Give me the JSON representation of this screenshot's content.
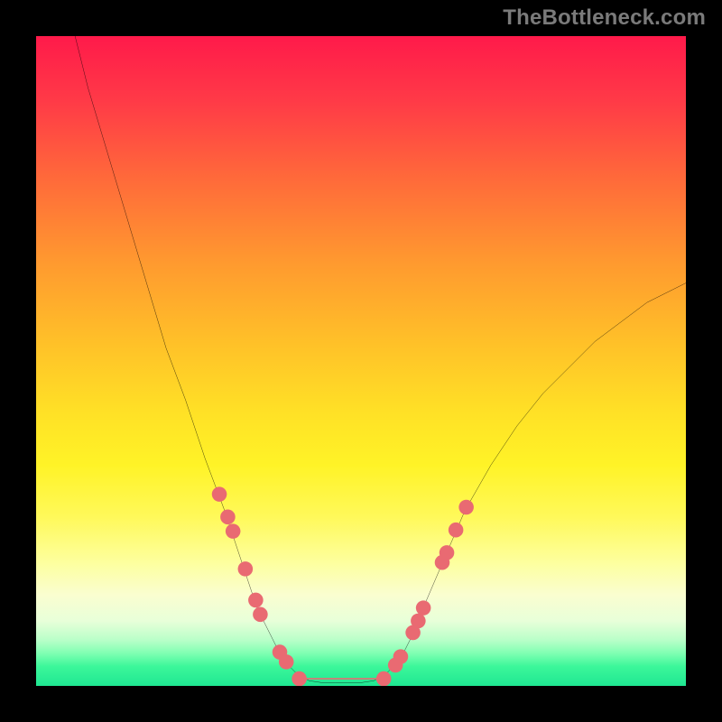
{
  "watermark": "TheBottleneck.com",
  "chart_data": {
    "type": "line",
    "title": "",
    "xlabel": "",
    "ylabel": "",
    "xlim": [
      0,
      100
    ],
    "ylim": [
      0,
      100
    ],
    "grid": false,
    "curve": [
      {
        "x": 6,
        "y": 100
      },
      {
        "x": 8,
        "y": 92
      },
      {
        "x": 11,
        "y": 82
      },
      {
        "x": 14,
        "y": 72
      },
      {
        "x": 17,
        "y": 62
      },
      {
        "x": 20,
        "y": 52
      },
      {
        "x": 23,
        "y": 44
      },
      {
        "x": 26,
        "y": 35
      },
      {
        "x": 29,
        "y": 27
      },
      {
        "x": 32,
        "y": 18
      },
      {
        "x": 34,
        "y": 12
      },
      {
        "x": 36,
        "y": 8
      },
      {
        "x": 38,
        "y": 4
      },
      {
        "x": 40,
        "y": 2
      },
      {
        "x": 42,
        "y": 0.8
      },
      {
        "x": 44,
        "y": 0.5
      },
      {
        "x": 46,
        "y": 0.5
      },
      {
        "x": 48,
        "y": 0.5
      },
      {
        "x": 50,
        "y": 0.5
      },
      {
        "x": 52,
        "y": 0.8
      },
      {
        "x": 54,
        "y": 2
      },
      {
        "x": 56,
        "y": 4
      },
      {
        "x": 58,
        "y": 8
      },
      {
        "x": 60,
        "y": 13
      },
      {
        "x": 63,
        "y": 20
      },
      {
        "x": 66,
        "y": 27
      },
      {
        "x": 70,
        "y": 34
      },
      {
        "x": 74,
        "y": 40
      },
      {
        "x": 78,
        "y": 45
      },
      {
        "x": 82,
        "y": 49
      },
      {
        "x": 86,
        "y": 53
      },
      {
        "x": 90,
        "y": 56
      },
      {
        "x": 94,
        "y": 59
      },
      {
        "x": 98,
        "y": 61
      },
      {
        "x": 100,
        "y": 62
      }
    ],
    "markers_left": [
      {
        "x": 28.2,
        "y": 29.5
      },
      {
        "x": 29.5,
        "y": 26.0
      },
      {
        "x": 30.3,
        "y": 23.8
      },
      {
        "x": 32.2,
        "y": 18.0
      },
      {
        "x": 33.8,
        "y": 13.2
      },
      {
        "x": 34.5,
        "y": 11.0
      },
      {
        "x": 37.5,
        "y": 5.2
      },
      {
        "x": 38.5,
        "y": 3.7
      }
    ],
    "markers_right": [
      {
        "x": 55.3,
        "y": 3.2
      },
      {
        "x": 56.1,
        "y": 4.5
      },
      {
        "x": 58.0,
        "y": 8.2
      },
      {
        "x": 58.8,
        "y": 10.0
      },
      {
        "x": 59.6,
        "y": 12.0
      },
      {
        "x": 62.5,
        "y": 19.0
      },
      {
        "x": 63.2,
        "y": 20.5
      },
      {
        "x": 64.6,
        "y": 24.0
      },
      {
        "x": 66.2,
        "y": 27.5
      }
    ],
    "floor_segment": {
      "x0": 40.5,
      "x1": 53.5,
      "y": 1.1
    },
    "floor_end_markers": [
      {
        "x": 40.5,
        "y": 1.1
      },
      {
        "x": 53.5,
        "y": 1.1
      }
    ],
    "marker_color": "#e96a72",
    "curve_color": "#000000",
    "background_gradient": [
      {
        "stop": 0,
        "color": "#ff1a4a"
      },
      {
        "stop": 100,
        "color": "#1fe792"
      }
    ]
  }
}
